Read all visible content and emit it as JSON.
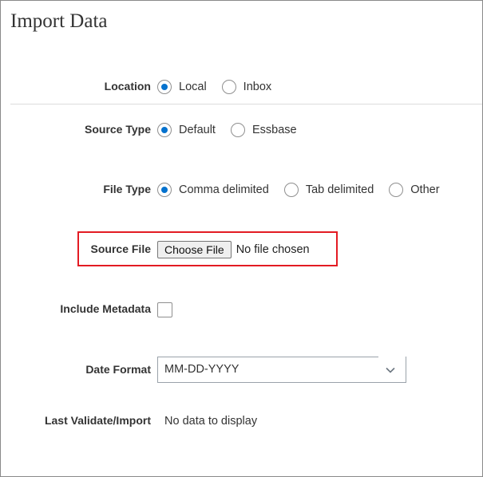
{
  "page": {
    "title": "Import Data"
  },
  "location": {
    "label": "Location",
    "options": [
      {
        "label": "Local",
        "selected": true
      },
      {
        "label": "Inbox",
        "selected": false
      }
    ]
  },
  "source_type": {
    "label": "Source Type",
    "options": [
      {
        "label": "Default",
        "selected": true
      },
      {
        "label": "Essbase",
        "selected": false
      }
    ]
  },
  "file_type": {
    "label": "File Type",
    "options": [
      {
        "label": "Comma delimited",
        "selected": true
      },
      {
        "label": "Tab delimited",
        "selected": false
      },
      {
        "label": "Other",
        "selected": false
      }
    ]
  },
  "source_file": {
    "label": "Source File",
    "button_label": "Choose File",
    "status": "No file chosen",
    "highlight_color": "#e31b23"
  },
  "include_metadata": {
    "label": "Include Metadata",
    "checked": false
  },
  "date_format": {
    "label": "Date Format",
    "value": "MM-DD-YYYY",
    "icon": "chevron-down-icon"
  },
  "last_validate": {
    "label": "Last Validate/Import",
    "value": "No data to display"
  },
  "colors": {
    "accent": "#0572ce",
    "text": "#333333",
    "border": "#8f8f8f"
  }
}
